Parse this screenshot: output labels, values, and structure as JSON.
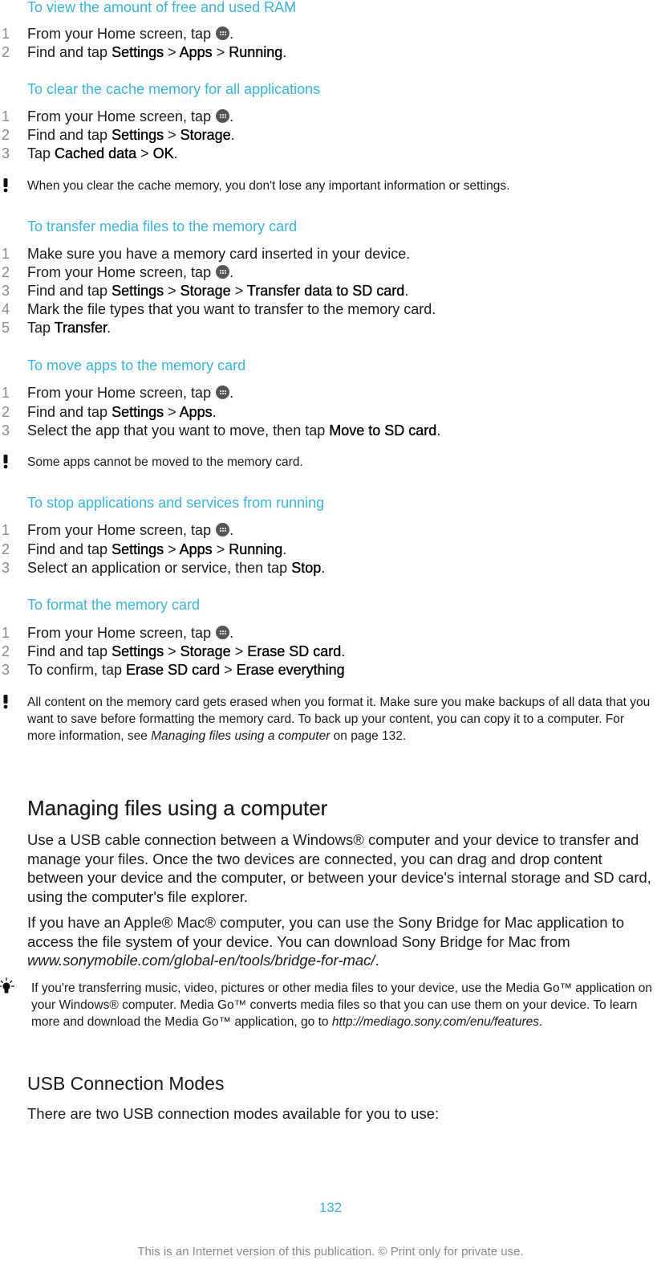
{
  "colors": {
    "accent": "#3cb4d8",
    "text": "#1a1a1a",
    "step_number": "#8a8a8a"
  },
  "icons": {
    "apps": "apps-grid-icon",
    "warning": "exclamation-icon",
    "tip": "lightbulb-icon"
  },
  "procedures": [
    {
      "title": "To view the amount of free and used RAM",
      "steps": [
        {
          "num": "1",
          "pre": "From your Home screen, tap ",
          "icon": true,
          "post": "."
        },
        {
          "num": "2",
          "pre": "Find and tap ",
          "bold": [
            "Settings",
            "Apps",
            "Running"
          ],
          "sep": " > ",
          "post": "."
        }
      ]
    },
    {
      "title": "To clear the cache memory for all applications",
      "steps": [
        {
          "num": "1",
          "pre": "From your Home screen, tap ",
          "icon": true,
          "post": "."
        },
        {
          "num": "2",
          "pre": "Find and tap ",
          "bold": [
            "Settings",
            "Storage"
          ],
          "sep": " > ",
          "post": "."
        },
        {
          "num": "3",
          "pre": "Tap ",
          "bold": [
            "Cached data",
            "OK"
          ],
          "sep": " > ",
          "post": "."
        }
      ],
      "note": "When you clear the cache memory, you don't lose any important information or settings."
    },
    {
      "title": "To transfer media files to the memory card",
      "steps": [
        {
          "num": "1",
          "pre": "Make sure you have a memory card inserted in your device."
        },
        {
          "num": "2",
          "pre": "From your Home screen, tap ",
          "icon": true,
          "post": "."
        },
        {
          "num": "3",
          "pre": "Find and tap ",
          "bold": [
            "Settings",
            "Storage",
            "Transfer data to SD card"
          ],
          "sep": " > ",
          "post": "."
        },
        {
          "num": "4",
          "pre": "Mark the file types that you want to transfer to the memory card."
        },
        {
          "num": "5",
          "pre": "Tap ",
          "bold": [
            "Transfer"
          ],
          "sep": " > ",
          "post": "."
        }
      ]
    },
    {
      "title": "To move apps to the memory card",
      "steps": [
        {
          "num": "1",
          "pre": "From your Home screen, tap ",
          "icon": true,
          "post": "."
        },
        {
          "num": "2",
          "pre": "Find and tap ",
          "bold": [
            "Settings",
            "Apps"
          ],
          "sep": " > ",
          "post": "."
        },
        {
          "num": "3",
          "pre": "Select the app that you want to move, then tap ",
          "bold": [
            "Move to SD card"
          ],
          "sep": " > ",
          "post": "."
        }
      ],
      "note": "Some apps cannot be moved to the memory card."
    },
    {
      "title": "To stop applications and services from running",
      "steps": [
        {
          "num": "1",
          "pre": "From your Home screen, tap ",
          "icon": true,
          "post": "."
        },
        {
          "num": "2",
          "pre": "Find and tap ",
          "bold": [
            "Settings",
            "Apps",
            "Running"
          ],
          "sep": " > ",
          "post": "."
        },
        {
          "num": "3",
          "pre": "Select an application or service, then tap ",
          "bold": [
            "Stop"
          ],
          "sep": " > ",
          "post": "."
        }
      ]
    },
    {
      "title": "To format the memory card",
      "steps": [
        {
          "num": "1",
          "pre": "From your Home screen, tap ",
          "icon": true,
          "post": "."
        },
        {
          "num": "2",
          "pre": "Find and tap ",
          "bold": [
            "Settings",
            "Storage",
            "Erase SD card"
          ],
          "sep": " > ",
          "post": "."
        },
        {
          "num": "3",
          "pre": "To confirm, tap ",
          "bold": [
            "Erase SD card",
            "Erase everything"
          ],
          "sep": " > ",
          "post": ""
        }
      ],
      "note_parts": {
        "before": "All content on the memory card gets erased when you format it. Make sure you make backups of all data that you want to save before formatting the memory card. To back up your content, you can copy it to a computer. For more information, see ",
        "link": "Managing files using a computer",
        "after": " on page 132."
      }
    }
  ],
  "section": {
    "heading": "Managing files using a computer",
    "para1": "Use a USB cable connection between a Windows® computer and your device to transfer and manage your files. Once the two devices are connected, you can drag and drop content between your device and the computer, or between your device's internal storage and SD card, using the computer's file explorer.",
    "para2_before": "If you have an Apple® Mac® computer, you can use the Sony Bridge for Mac application to access the file system of your device. You can download Sony Bridge for Mac from ",
    "para2_link": "www.sonymobile.com/global-en/tools/bridge-for-mac/",
    "para2_after": ".",
    "tip_before": "If you're transferring music, video, pictures or other media files to your device, use the Media Go™ application on your Windows® computer. Media Go™ converts media files so that you can use them on your device. To learn more and download the Media Go™ application, go to ",
    "tip_link": "http://mediago.sony.com/enu/features",
    "tip_after": "."
  },
  "subsection": {
    "heading": "USB Connection Modes",
    "para": "There are two USB connection modes available for you to use:"
  },
  "page_number": "132",
  "footer": "This is an Internet version of this publication. © Print only for private use."
}
